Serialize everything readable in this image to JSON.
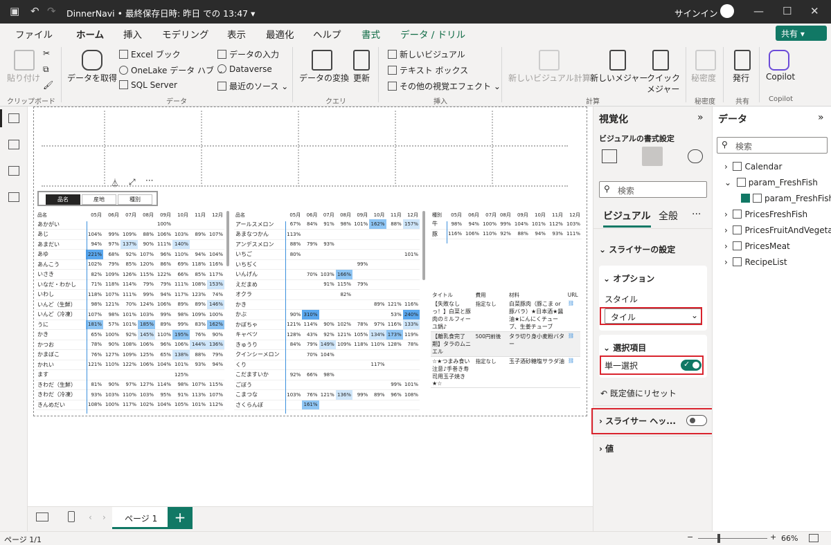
{
  "title": {
    "app": "DinnerNavi • 最終保存日時: 昨日 での 13:47 ▾",
    "signin": "サインイン"
  },
  "tabs": [
    "ファイル",
    "ホーム",
    "挿入",
    "モデリング",
    "表示",
    "最適化",
    "ヘルプ",
    "書式",
    "データ / ドリル"
  ],
  "share": "共有 ▾",
  "ribbon": {
    "paste": "貼り付け",
    "getdata": "データを取得",
    "excel": "Excel ブック",
    "onelake": "OneLake データ ハブ ⌄",
    "sql": "SQL Server",
    "enter": "データの入力",
    "dataverse": "Dataverse",
    "recent": "最近のソース ⌄",
    "transform": "データの変換",
    "refresh": "更新",
    "newvisual": "新しいビジュアル",
    "textbox": "テキスト ボックス",
    "moreviz": "その他の視覚エフェクト ⌄",
    "newcalc": "新しいビジュアル計算",
    "newmeasure": "新しいメジャー",
    "quickmeasure": "クイック",
    "quickmeasure2": "メジャー",
    "sensitivity": "秘密度",
    "publish": "発行",
    "copilot": "Copilot",
    "groups": {
      "clipboard": "クリップボード",
      "data": "データ",
      "query": "クエリ",
      "insert": "挿入",
      "calc": "計算",
      "sens": "秘密度",
      "share": "共有",
      "copilot": "Copilot"
    }
  },
  "slicer": {
    "b1": "品名",
    "b2": "産地",
    "b3": "種別"
  },
  "months": [
    "05月",
    "06月",
    "07月",
    "08月",
    "09月",
    "10月",
    "11月",
    "12月"
  ],
  "t1": {
    "header": "品名",
    "rows": [
      [
        "あかがい",
        "",
        "",
        "",
        "",
        "100%",
        "",
        "",
        ""
      ],
      [
        "あじ",
        "104%",
        "99%",
        "109%",
        "88%",
        "106%",
        "103%",
        "89%",
        "107%"
      ],
      [
        "あまだい",
        "94%",
        "97%",
        "137%",
        "90%",
        "111%",
        "140%",
        "",
        ""
      ],
      [
        "あゆ",
        "221%",
        "68%",
        "92%",
        "107%",
        "96%",
        "110%",
        "94%",
        "104%"
      ],
      [
        "あんこう",
        "102%",
        "79%",
        "85%",
        "120%",
        "86%",
        "69%",
        "118%",
        "116%"
      ],
      [
        "いさき",
        "82%",
        "109%",
        "126%",
        "115%",
        "122%",
        "66%",
        "85%",
        "117%"
      ],
      [
        "いなだ・わかし",
        "71%",
        "118%",
        "114%",
        "79%",
        "79%",
        "111%",
        "108%",
        "153%"
      ],
      [
        "いわし",
        "118%",
        "107%",
        "111%",
        "99%",
        "94%",
        "117%",
        "123%",
        "74%"
      ],
      [
        "いんど（生鮮）",
        "98%",
        "121%",
        "70%",
        "124%",
        "106%",
        "89%",
        "89%",
        "146%"
      ],
      [
        "いんど（冷凍）",
        "107%",
        "98%",
        "101%",
        "103%",
        "99%",
        "98%",
        "109%",
        "100%"
      ],
      [
        "うに",
        "181%",
        "57%",
        "101%",
        "185%",
        "89%",
        "99%",
        "83%",
        "162%"
      ],
      [
        "かき",
        "65%",
        "100%",
        "92%",
        "145%",
        "110%",
        "195%",
        "76%",
        "90%"
      ],
      [
        "かつお",
        "78%",
        "90%",
        "108%",
        "106%",
        "96%",
        "106%",
        "144%",
        "136%"
      ],
      [
        "かまぼこ",
        "76%",
        "127%",
        "109%",
        "125%",
        "65%",
        "138%",
        "88%",
        "79%"
      ],
      [
        "かれい",
        "121%",
        "110%",
        "122%",
        "106%",
        "104%",
        "101%",
        "93%",
        "94%"
      ],
      [
        "ます",
        "",
        "",
        "",
        "",
        "",
        "125%",
        "",
        ""
      ],
      [
        "きわだ（生鮮）",
        "81%",
        "90%",
        "97%",
        "127%",
        "114%",
        "98%",
        "107%",
        "115%"
      ],
      [
        "きわだ（冷凍）",
        "93%",
        "103%",
        "110%",
        "103%",
        "95%",
        "91%",
        "113%",
        "107%"
      ],
      [
        "きんめだい",
        "108%",
        "100%",
        "117%",
        "102%",
        "104%",
        "105%",
        "101%",
        "112%"
      ]
    ]
  },
  "t2": {
    "header": "品名",
    "rows": [
      [
        "アールスメロン",
        "67%",
        "84%",
        "91%",
        "98%",
        "101%",
        "162%",
        "88%",
        "157%"
      ],
      [
        "あまなつかん",
        "113%",
        "",
        "",
        "",
        "",
        "",
        "",
        ""
      ],
      [
        "アンデスメロン",
        "88%",
        "79%",
        "93%",
        "",
        "",
        "",
        "",
        ""
      ],
      [
        "いちご",
        "80%",
        "",
        "",
        "",
        "",
        "",
        "",
        "101%"
      ],
      [
        "いちぢく",
        "",
        "",
        "",
        "",
        "99%",
        "",
        "",
        ""
      ],
      [
        "いんげん",
        "",
        "70%",
        "103%",
        "166%",
        "",
        "",
        "",
        ""
      ],
      [
        "えだまめ",
        "",
        "",
        "91%",
        "115%",
        "79%",
        "",
        "",
        ""
      ],
      [
        "オクラ",
        "",
        "",
        "",
        "82%",
        "",
        "",
        "",
        ""
      ],
      [
        "かき",
        "",
        "",
        "",
        "",
        "",
        "89%",
        "121%",
        "116%"
      ],
      [
        "かぶ",
        "90%",
        "310%",
        "",
        "",
        "",
        "",
        "53%",
        "240%"
      ],
      [
        "かぼちゃ",
        "121%",
        "114%",
        "90%",
        "102%",
        "78%",
        "97%",
        "116%",
        "133%"
      ],
      [
        "キャベツ",
        "128%",
        "43%",
        "92%",
        "121%",
        "105%",
        "134%",
        "173%",
        "119%"
      ],
      [
        "きゅうり",
        "84%",
        "79%",
        "149%",
        "109%",
        "118%",
        "110%",
        "128%",
        "78%"
      ],
      [
        "クインシーメロン",
        "",
        "70%",
        "104%",
        "",
        "",
        "",
        "",
        ""
      ],
      [
        "くり",
        "",
        "",
        "",
        "",
        "",
        "117%",
        "",
        ""
      ],
      [
        "こだますいか",
        "92%",
        "66%",
        "98%",
        "",
        "",
        "",
        "",
        ""
      ],
      [
        "ごぼう",
        "",
        "",
        "",
        "",
        "",
        "",
        "99%",
        "101%"
      ],
      [
        "こまつな",
        "103%",
        "76%",
        "121%",
        "136%",
        "99%",
        "89%",
        "96%",
        "108%"
      ],
      [
        "さくらんぼ",
        "",
        "161%",
        "",
        "",
        "",
        "",
        "",
        ""
      ]
    ]
  },
  "t3": {
    "header": "種別",
    "rows": [
      [
        "牛",
        "98%",
        "94%",
        "100%",
        "99%",
        "104%",
        "101%",
        "112%",
        "103%"
      ],
      [
        "豚",
        "116%",
        "106%",
        "110%",
        "92%",
        "88%",
        "94%",
        "93%",
        "111%"
      ]
    ]
  },
  "recipes": {
    "h": [
      "タイトル",
      "費用",
      "材料",
      "URL"
    ],
    "rows": [
      [
        "【失敗なしっ！】白菜と豚肉のミルフィーユ鍋♪",
        "指定なし",
        "白菜豚肉（豚こま or豚バラ）★日本酒★醤油★にんにくチューブ、生姜チューブ"
      ],
      [
        "【離乳食完了期】タラのムニエル",
        "500円前後",
        "タラ切り身小麦粉バター"
      ],
      [
        "☆★つまみ食い注意♪手巻き寿司用玉子焼き★☆",
        "指定なし",
        "玉子酒砂糖塩サラダ油"
      ]
    ]
  },
  "pagebar": {
    "page": "ページ 1",
    "add": "+"
  },
  "status": {
    "left": "ページ 1/1",
    "zoom": "66%"
  },
  "viz": {
    "title": "視覚化",
    "sub": "ビジュアルの書式設定",
    "search": "検索",
    "tab1": "ビジュアル",
    "tab2": "全般",
    "more": "···",
    "slicer_settings": "スライサーの設定",
    "options": "オプション",
    "style_label": "スタイル",
    "style_value": "タイル",
    "selection": "選択項目",
    "single": "単一選択",
    "reset": "既定値にリセット",
    "header": "スライサー ヘッ...",
    "values": "値"
  },
  "data": {
    "title": "データ",
    "search": "検索",
    "items": [
      "Calendar",
      "param_FreshFish",
      "param_FreshFish",
      "PricesFreshFish",
      "PricesFruitAndVegeta...",
      "PricesMeat",
      "RecipeList"
    ]
  }
}
